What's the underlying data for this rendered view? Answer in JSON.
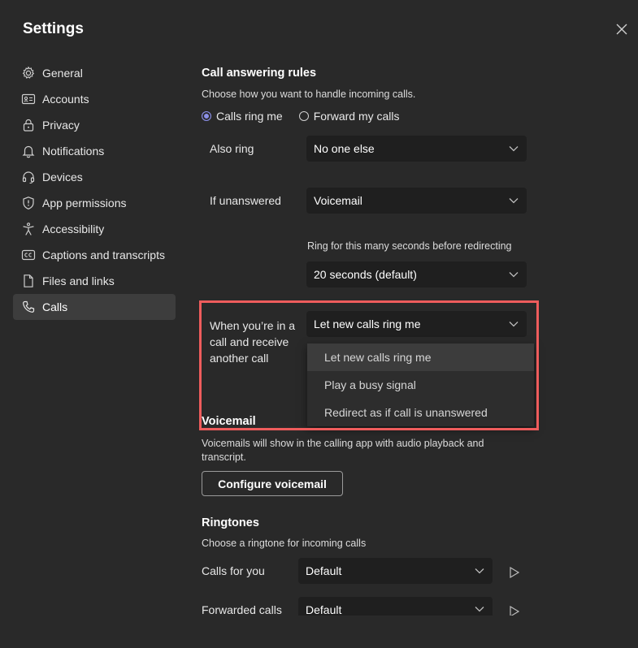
{
  "window": {
    "title": "Settings"
  },
  "sidebar": {
    "items": [
      {
        "label": "General",
        "icon": "gear-icon"
      },
      {
        "label": "Accounts",
        "icon": "id-card-icon"
      },
      {
        "label": "Privacy",
        "icon": "lock-icon"
      },
      {
        "label": "Notifications",
        "icon": "bell-icon"
      },
      {
        "label": "Devices",
        "icon": "headset-icon"
      },
      {
        "label": "App permissions",
        "icon": "shield-icon"
      },
      {
        "label": "Accessibility",
        "icon": "accessibility-icon"
      },
      {
        "label": "Captions and transcripts",
        "icon": "cc-icon"
      },
      {
        "label": "Files and links",
        "icon": "file-icon"
      },
      {
        "label": "Calls",
        "icon": "phone-icon",
        "active": true
      }
    ]
  },
  "call_answering": {
    "heading": "Call answering rules",
    "description": "Choose how you want to handle incoming calls.",
    "radio_ring_me": "Calls ring me",
    "radio_forward": "Forward my calls",
    "also_ring_label": "Also ring",
    "also_ring_value": "No one else",
    "if_unanswered_label": "If unanswered",
    "if_unanswered_value": "Voicemail",
    "ring_seconds_label": "Ring for this many seconds before redirecting",
    "ring_seconds_value": "20 seconds (default)",
    "in_call_label_line1": "When you’re in a",
    "in_call_label_line2": "call and receive",
    "in_call_label_line3": "another call",
    "in_call_value": "Let new calls ring me",
    "in_call_options": [
      "Let new calls ring me",
      "Play a busy signal",
      "Redirect as if call is unanswered"
    ]
  },
  "voicemail": {
    "heading": "Voicemail",
    "description_line1": "Voicemails will show in the calling app with audio playback and",
    "description_line2": "transcript.",
    "button": "Configure voicemail"
  },
  "ringtones": {
    "heading": "Ringtones",
    "description": "Choose a ringtone for incoming calls",
    "calls_for_you_label": "Calls for you",
    "calls_for_you_value": "Default",
    "forwarded_label": "Forwarded calls",
    "forwarded_value": "Default"
  },
  "colors": {
    "background": "#292929",
    "accent": "#8b8fe8",
    "highlight": "#ee5c5c"
  }
}
